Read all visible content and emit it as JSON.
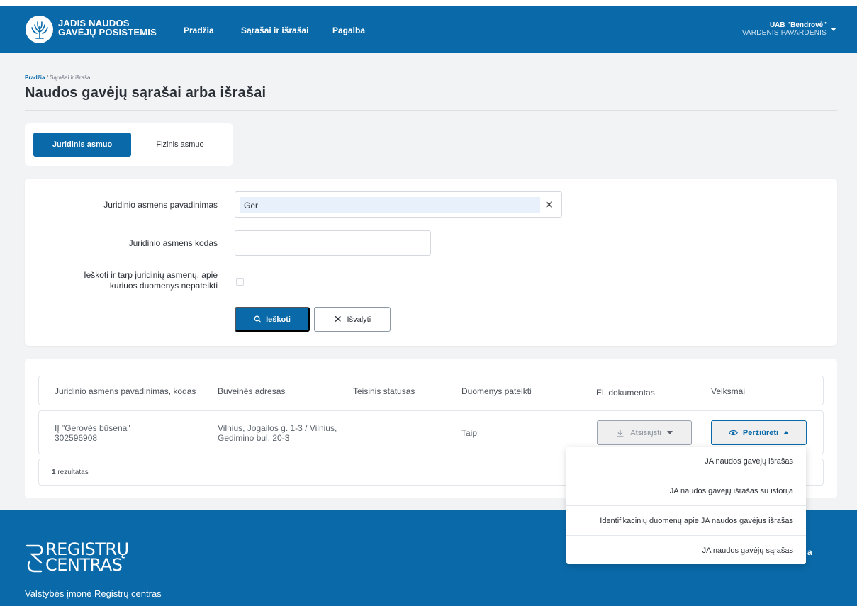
{
  "header": {
    "brand_line1": "JADIS NAUDOS",
    "brand_line2": "GAVĖJŲ POSISTEMIS",
    "nav": [
      "Pradžia",
      "Sąrašai ir išrašai",
      "Pagalba"
    ],
    "user_company": "UAB \"Bendrovė\"",
    "user_name": "VARDENIS PAVARDENIS"
  },
  "breadcrumb": {
    "home": "Pradžia",
    "separator": " / ",
    "current": "Sąrašai ir išrašai"
  },
  "page_title": "Naudos gavėjų sąrašai arba išrašai",
  "tabs": {
    "active": "Juridinis asmuo",
    "inactive": "Fizinis asmuo"
  },
  "form": {
    "name_label": "Juridinio asmens pavadinimas",
    "name_value": "Ger",
    "code_label": "Juridinio asmens kodas",
    "code_value": "",
    "checkbox_label_line1": "Ieškoti ir tarp juridinių asmenų, apie",
    "checkbox_label_line2": "kuriuos duomenys nepateikti",
    "search_button": "Ieškoti",
    "clear_button": "Išvalyti"
  },
  "table": {
    "headers": [
      "Juridinio asmens pavadinimas, kodas",
      "Buveinės adresas",
      "Teisinis statusas",
      "Duomenys pateikti",
      "El. dokumentas",
      "Veiksmai"
    ],
    "rows": [
      {
        "name": "IĮ \"Gerovės būsena\"",
        "code": "302596908",
        "address_line1": "Vilnius, Jogailos g. 1-3 / Vilnius,",
        "address_line2": "Gedimino bul. 20-3",
        "status": "",
        "submitted": "Taip",
        "download_button": "Atsisiųsti",
        "view_button": "Peržiūrėti"
      }
    ],
    "result_count": "1",
    "result_label": " rezultatas"
  },
  "dropdown": {
    "items": [
      "JA naudos gavėjų išrašas",
      "JA naudos gavėjų išrašas su istorija",
      "Identifikacinių duomenų apie JA naudos gavėjus išrašas",
      "JA naudos gavėjų sąrašas"
    ]
  },
  "footer": {
    "logo_line1": "REGISTRŲ",
    "logo_line2": "CENTRAS",
    "company": "Valstybės įmonė Registrų centras",
    "partial_text": "a"
  },
  "colors": {
    "primary": "#0a6aa9",
    "background": "#f2f3f5",
    "input_fill": "#e8f0fb"
  },
  "icons": [
    "tree-logo-icon",
    "user-caret-icon",
    "search-icon",
    "close-icon",
    "download-icon",
    "caret-down-icon",
    "eye-icon",
    "caret-up-icon",
    "registru-centras-logo-icon"
  ]
}
